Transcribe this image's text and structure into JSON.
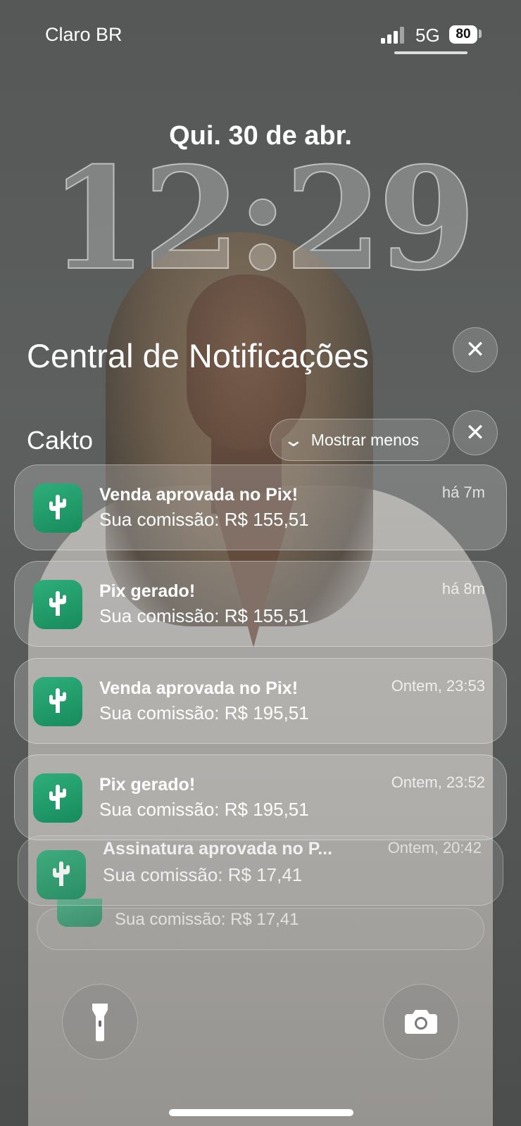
{
  "status_bar": {
    "carrier": "Claro BR",
    "network": "5G",
    "battery": "80",
    "icons": [
      "cellular-signal-icon",
      "battery-icon"
    ]
  },
  "lock_screen": {
    "date": "Qui. 30 de abr.",
    "time": "12:29"
  },
  "notification_center": {
    "title": "Central de Notificações",
    "close_glyph": "✕",
    "group": {
      "app_name": "Cakto",
      "show_less_label": "Mostrar menos",
      "close_glyph": "✕"
    },
    "notifications": [
      {
        "title": "Venda aprovada no Pix!",
        "body": "Sua comissão: R$ 155,51",
        "time": "há 7m"
      },
      {
        "title": "Pix gerado!",
        "body": "Sua comissão: R$ 155,51",
        "time": "há 8m"
      },
      {
        "title": "Venda aprovada no Pix!",
        "body": "Sua comissão: R$ 195,51",
        "time": "Ontem, 23:53"
      },
      {
        "title": "Pix gerado!",
        "body": "Sua comissão: R$ 195,51",
        "time": "Ontem, 23:52"
      }
    ],
    "stacked": [
      {
        "title": "Assinatura aprovada no P...",
        "body": "Sua comissão: R$ 17,41",
        "time": "Ontem, 20:42"
      },
      {
        "body": "Sua comissão: R$ 17,41"
      }
    ]
  },
  "controls": {
    "left": "flashlight-icon",
    "right": "camera-icon"
  },
  "colors": {
    "app_icon": "#1f9c6b",
    "background": "#5f6261"
  }
}
